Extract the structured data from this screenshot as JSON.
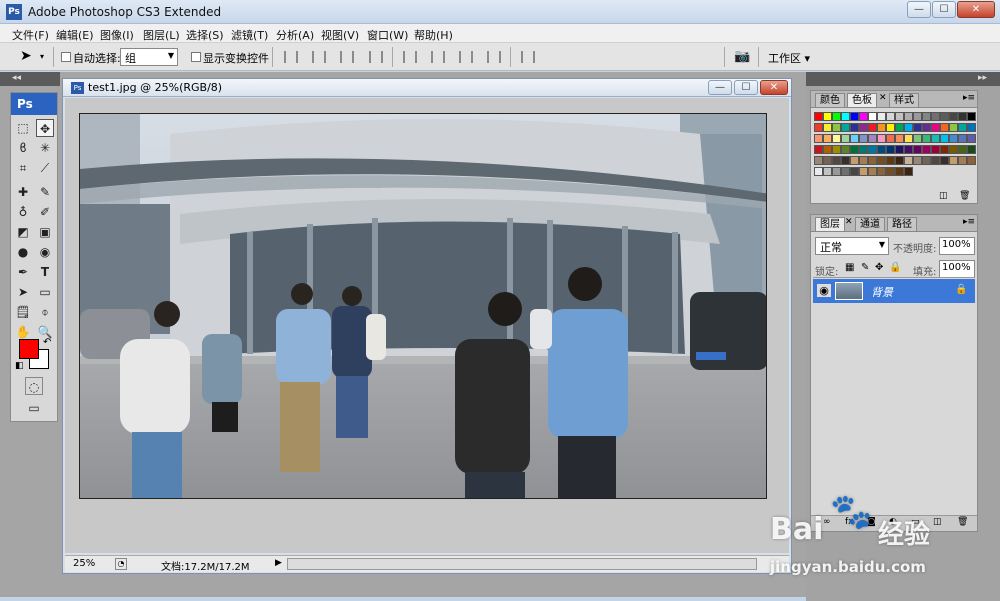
{
  "app": {
    "title": "Adobe Photoshop CS3 Extended",
    "logo": "Ps"
  },
  "window_controls": {
    "minimize": "—",
    "maximize": "☐",
    "close": "✕"
  },
  "menu": [
    "文件(F)",
    "编辑(E)",
    "图像(I)",
    "图层(L)",
    "选择(S)",
    "滤镜(T)",
    "分析(A)",
    "视图(V)",
    "窗口(W)",
    "帮助(H)"
  ],
  "options_bar": {
    "auto_select_label": "自动选择:",
    "auto_select_value": "组",
    "show_transform_label": "显示变换控件",
    "workspace_label": "工作区 ▾"
  },
  "toolbox": {
    "title": "Ps",
    "tools": [
      "marquee",
      "move",
      "lasso",
      "magic-wand",
      "crop",
      "slice",
      "healing",
      "brush",
      "stamp",
      "history-brush",
      "eraser",
      "gradient",
      "blur",
      "dodge",
      "pen",
      "type",
      "path-select",
      "shape",
      "notes",
      "eyedropper",
      "hand",
      "zoom"
    ],
    "foreground_color": "#ff0000",
    "background_color": "#ffffff"
  },
  "document": {
    "title": "test1.jpg @ 25%(RGB/8)",
    "icon": "Ps",
    "zoom": "25%",
    "doc_info": "文档:17.2M/17.2M"
  },
  "panels": {
    "swatches": {
      "tabs": [
        "颜色",
        "色板",
        "样式"
      ],
      "active_tab": "色板"
    },
    "layers": {
      "tabs": [
        "图层",
        "通道",
        "路径"
      ],
      "active_tab": "图层",
      "blend_mode": "正常",
      "opacity_label": "不透明度:",
      "opacity_value": "100%",
      "lock_label": "锁定:",
      "fill_label": "填充:",
      "fill_value": "100%",
      "layer_name": "背景"
    }
  },
  "watermark": {
    "brand": "Bai",
    "brand2": "经验",
    "url": "jingyan.baidu.com"
  }
}
